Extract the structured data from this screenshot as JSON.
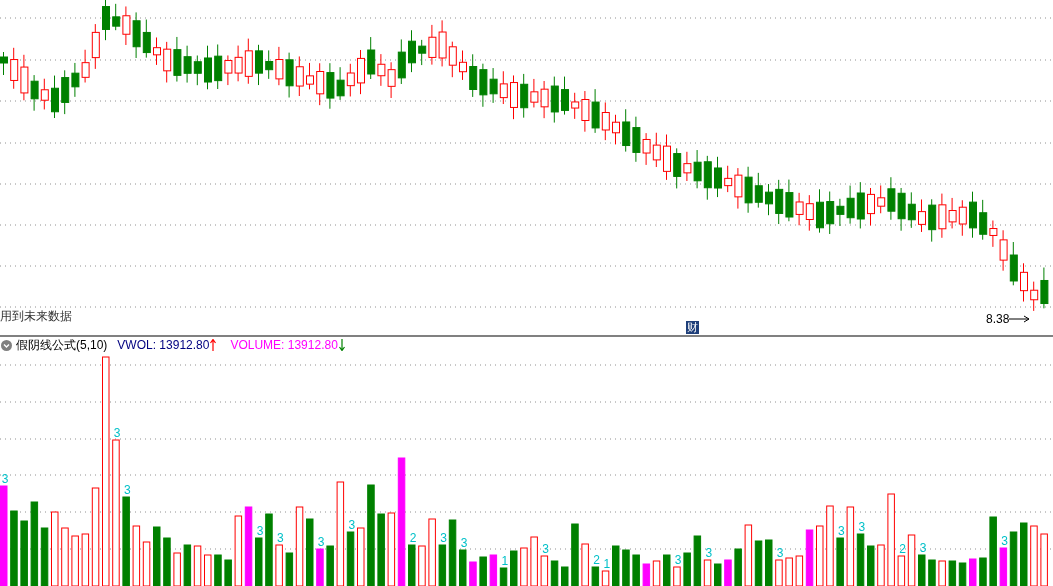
{
  "price_panel": {
    "note": "用到未来数据",
    "finance_badge": "财",
    "last_price": "8.38"
  },
  "indicator_header": {
    "name": "假阴线公式(5,10)",
    "series": [
      {
        "label": "VWOL: 13912.80",
        "color": "#000080",
        "kind": "up"
      },
      {
        "label": "VOLUME: 13912.80",
        "color": "#ff00ff",
        "kind": "down"
      }
    ]
  },
  "volume_bars": [
    {
      "kind": "limit",
      "label": "3"
    },
    {
      "kind": "down"
    },
    {
      "kind": "down"
    },
    {
      "kind": "down"
    },
    {
      "kind": "down"
    },
    {
      "kind": "up"
    },
    {
      "kind": "up"
    },
    {
      "kind": "up"
    },
    {
      "kind": "up"
    },
    {
      "kind": "up"
    },
    {
      "kind": "up"
    },
    {
      "kind": "up",
      "label": "3"
    },
    {
      "kind": "down",
      "label": "3"
    },
    {
      "kind": "up"
    },
    {
      "kind": "up"
    },
    {
      "kind": "down"
    },
    {
      "kind": "down"
    },
    {
      "kind": "up"
    },
    {
      "kind": "down"
    },
    {
      "kind": "up"
    },
    {
      "kind": "up"
    },
    {
      "kind": "down"
    },
    {
      "kind": "down"
    },
    {
      "kind": "up"
    },
    {
      "kind": "limit"
    },
    {
      "kind": "down",
      "label": "3"
    },
    {
      "kind": "down"
    },
    {
      "kind": "up",
      "label": "3"
    },
    {
      "kind": "down"
    },
    {
      "kind": "up"
    },
    {
      "kind": "down"
    },
    {
      "kind": "limit",
      "label": "3"
    },
    {
      "kind": "down"
    },
    {
      "kind": "up"
    },
    {
      "kind": "down",
      "label": "3"
    },
    {
      "kind": "up"
    },
    {
      "kind": "down"
    },
    {
      "kind": "down"
    },
    {
      "kind": "up"
    },
    {
      "kind": "limit"
    },
    {
      "kind": "down",
      "label": "2"
    },
    {
      "kind": "up"
    },
    {
      "kind": "up"
    },
    {
      "kind": "down",
      "label": "3"
    },
    {
      "kind": "down"
    },
    {
      "kind": "down",
      "label": "3"
    },
    {
      "kind": "limit"
    },
    {
      "kind": "down"
    },
    {
      "kind": "limit"
    },
    {
      "kind": "down",
      "label": "1"
    },
    {
      "kind": "down"
    },
    {
      "kind": "up"
    },
    {
      "kind": "up"
    },
    {
      "kind": "up",
      "label": "3"
    },
    {
      "kind": "down"
    },
    {
      "kind": "down"
    },
    {
      "kind": "down"
    },
    {
      "kind": "up"
    },
    {
      "kind": "down",
      "label": "2"
    },
    {
      "kind": "up",
      "label": "1"
    },
    {
      "kind": "down"
    },
    {
      "kind": "down"
    },
    {
      "kind": "down"
    },
    {
      "kind": "limit"
    },
    {
      "kind": "up"
    },
    {
      "kind": "down"
    },
    {
      "kind": "up",
      "label": "3"
    },
    {
      "kind": "down"
    },
    {
      "kind": "down"
    },
    {
      "kind": "up",
      "label": "3"
    },
    {
      "kind": "down"
    },
    {
      "kind": "limit"
    },
    {
      "kind": "down"
    },
    {
      "kind": "up"
    },
    {
      "kind": "down"
    },
    {
      "kind": "down"
    },
    {
      "kind": "up",
      "label": "3"
    },
    {
      "kind": "up"
    },
    {
      "kind": "up"
    },
    {
      "kind": "limit"
    },
    {
      "kind": "up"
    },
    {
      "kind": "up"
    },
    {
      "kind": "down",
      "label": "3"
    },
    {
      "kind": "up"
    },
    {
      "kind": "down",
      "label": "3"
    },
    {
      "kind": "down"
    },
    {
      "kind": "up"
    },
    {
      "kind": "up"
    },
    {
      "kind": "up",
      "label": "2"
    },
    {
      "kind": "up"
    },
    {
      "kind": "down",
      "label": "3"
    },
    {
      "kind": "down"
    },
    {
      "kind": "up"
    },
    {
      "kind": "down"
    },
    {
      "kind": "down"
    },
    {
      "kind": "limit"
    },
    {
      "kind": "down"
    },
    {
      "kind": "down"
    },
    {
      "kind": "limit",
      "label": "3"
    },
    {
      "kind": "down"
    },
    {
      "kind": "down"
    },
    {
      "kind": "up"
    },
    {
      "kind": "up"
    }
  ]
}
